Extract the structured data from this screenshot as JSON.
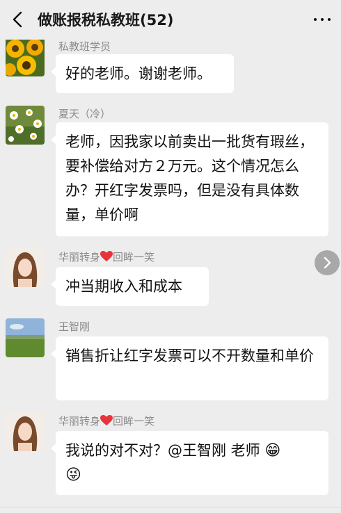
{
  "header": {
    "title": "做账报税私教班(52)",
    "back_icon": "back-chevron-icon",
    "more_icon": "more-dots-icon"
  },
  "messages": [
    {
      "sender": "私教班学员",
      "text": "好的老师。谢谢老师。",
      "avatar": "sunflower-avatar"
    },
    {
      "sender": "夏天（冷）",
      "text": "老师，因我家以前卖出一批货有瑕丝，要补偿给对方２万元。这个情况怎么办？开红字发票吗，但是没有具体数量，单价啊",
      "avatar": "daisy-avatar"
    },
    {
      "sender_prefix": "华丽转身",
      "sender_suffix": "回眸一笑",
      "text": "冲当期收入和成本",
      "avatar": "woman-avatar"
    },
    {
      "sender": "王智刚",
      "text": "销售折让红字发票可以不开数量和单价",
      "avatar": "meadow-avatar"
    },
    {
      "sender_prefix": "华丽转身",
      "sender_suffix": "回眸一笑",
      "text": "我说的对不对？@王智刚   老师",
      "emoji_1": "😁",
      "emoji_2": "😜",
      "avatar": "woman-avatar"
    }
  ],
  "colors": {
    "background": "#ededed",
    "bubble": "#ffffff",
    "sender_text": "#8a8a8a",
    "heart": "#e8333a"
  }
}
